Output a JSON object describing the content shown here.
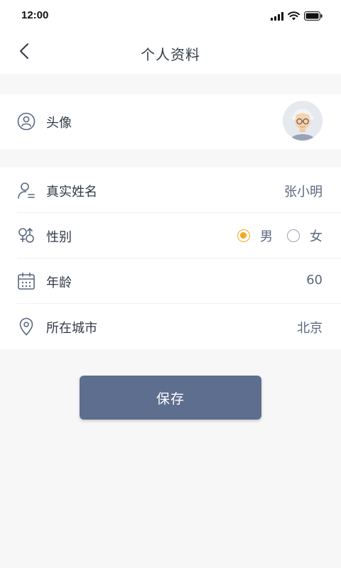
{
  "status_bar": {
    "time": "12:00"
  },
  "header": {
    "title": "个人资料"
  },
  "avatar_row": {
    "label": "头像"
  },
  "fields": {
    "real_name": {
      "label": "真实姓名",
      "value": "张小明"
    },
    "gender": {
      "label": "性别",
      "options": [
        "男",
        "女"
      ],
      "selected": "男"
    },
    "age": {
      "label": "年龄",
      "value": "60"
    },
    "city": {
      "label": "所在城市",
      "value": "北京"
    }
  },
  "actions": {
    "save_label": "保存"
  },
  "colors": {
    "primary": "#5d6e8e",
    "accent": "#f5a623",
    "value_text": "#5b6780"
  }
}
